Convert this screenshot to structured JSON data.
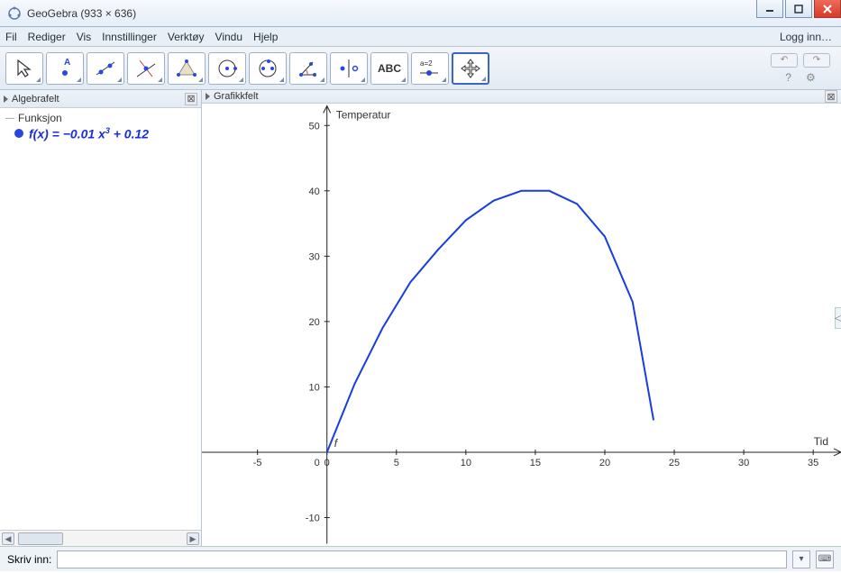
{
  "window": {
    "title": "GeoGebra (933 × 636)"
  },
  "menu": {
    "items": [
      "Fil",
      "Rediger",
      "Vis",
      "Innstillinger",
      "Verktøy",
      "Vindu",
      "Hjelp"
    ],
    "login": "Logg inn…"
  },
  "tools": [
    {
      "name": "move",
      "icon": "cursor"
    },
    {
      "name": "point",
      "icon": "pointA"
    },
    {
      "name": "line",
      "icon": "line2pt"
    },
    {
      "name": "perpendicular",
      "icon": "perp"
    },
    {
      "name": "polygon",
      "icon": "triangle"
    },
    {
      "name": "circle-center-point",
      "icon": "circle1"
    },
    {
      "name": "ellipse",
      "icon": "circle2"
    },
    {
      "name": "angle",
      "icon": "angle"
    },
    {
      "name": "reflect",
      "icon": "reflect"
    },
    {
      "name": "text",
      "icon": "ABC"
    },
    {
      "name": "slider",
      "icon": "slider"
    },
    {
      "name": "move-view",
      "icon": "pan",
      "selected": true
    }
  ],
  "undo": "↶",
  "redo": "↷",
  "helpIcon": "?",
  "settingsIcon": "⚙",
  "panels": {
    "algebra": {
      "title": "Algebrafelt",
      "category": "Funksjon",
      "function_label": "f(x) = −0.01 x³ + 0.12"
    },
    "graphics": {
      "title": "Grafikkfelt"
    }
  },
  "input": {
    "label": "Skriv inn:",
    "value": ""
  },
  "chart_data": {
    "type": "line",
    "title": "",
    "xlabel": "Tid",
    "ylabel": "Temperatur",
    "curve_label": "f",
    "xlim": [
      -9,
      37
    ],
    "ylim": [
      -14,
      53
    ],
    "xticks": [
      -5,
      0,
      5,
      10,
      15,
      20,
      25,
      30,
      35
    ],
    "yticks": [
      -10,
      10,
      20,
      30,
      40,
      50
    ],
    "series": [
      {
        "name": "f",
        "color": "#1a3de0",
        "x": [
          0,
          2,
          4,
          6,
          8,
          10,
          12,
          14,
          16,
          18,
          20,
          22,
          23.5
        ],
        "y": [
          0,
          10.5,
          19,
          26,
          31,
          35.5,
          38.5,
          40,
          40,
          38,
          33,
          23,
          5
        ]
      }
    ]
  }
}
